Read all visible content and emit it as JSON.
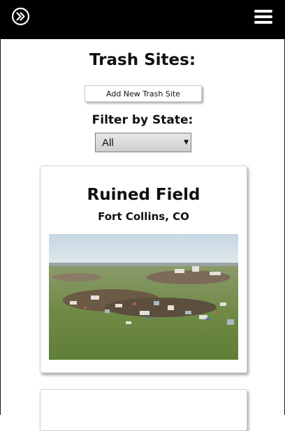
{
  "header": {
    "logo_icon": "circled-double-chevron-icon",
    "menu_icon": "hamburger-menu-icon"
  },
  "page": {
    "title": "Trash Sites:",
    "add_button_label": "Add New Trash Site",
    "filter_label": "Filter by State:",
    "filter_selected": "All"
  },
  "sites": [
    {
      "name": "Ruined Field",
      "location": "Fort Collins, CO",
      "image": "photo of grassy field with scattered trash piles"
    }
  ],
  "colors": {
    "header_bg": "#000000",
    "page_bg": "#ffffff",
    "text": "#111111"
  }
}
